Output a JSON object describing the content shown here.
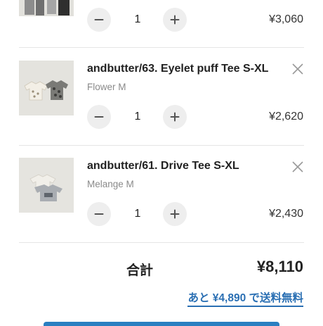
{
  "cart": {
    "items": [
      {
        "name": "",
        "variant": "",
        "quantity": "1",
        "price": "¥3,060",
        "thumb_icon": "product-photo-pants",
        "remove_icon": "close-icon"
      },
      {
        "name": "andbutter/63. Eyelet puff Tee S-XL",
        "variant": "Flower M",
        "quantity": "1",
        "price": "¥2,620",
        "thumb_icon": "product-photo-tees",
        "remove_icon": "close-icon"
      },
      {
        "name": "andbutter/61. Drive Tee S-XL",
        "variant": "Melange M",
        "quantity": "1",
        "price": "¥2,430",
        "thumb_icon": "product-photo-tee",
        "remove_icon": "close-icon"
      }
    ],
    "total_label": "合計",
    "total_value": "¥8,110",
    "free_shipping_note": "あと ¥4,890 で送料無料",
    "accent_color": "#2a6fb3"
  }
}
